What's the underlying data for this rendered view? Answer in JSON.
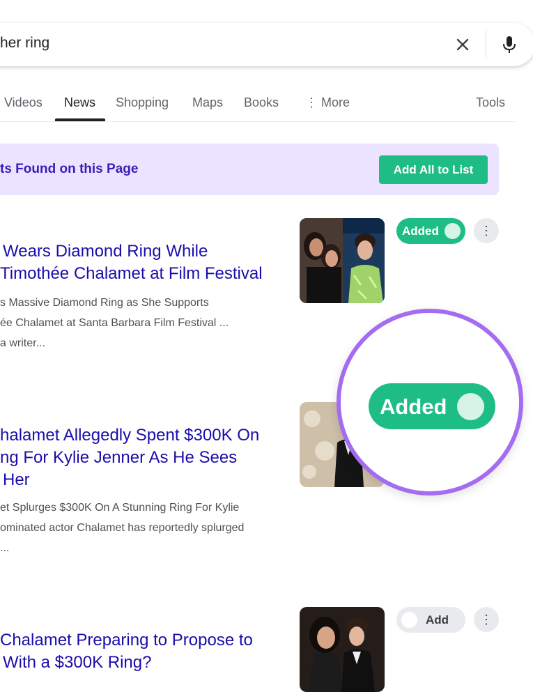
{
  "search": {
    "query_visible": "her ring"
  },
  "tabs": [
    {
      "label": "Videos"
    },
    {
      "label": "News"
    },
    {
      "label": "Shopping"
    },
    {
      "label": "Maps"
    },
    {
      "label": "Books"
    },
    {
      "label": "More"
    },
    {
      "label": "Tools"
    }
  ],
  "banner": {
    "text": "ts Found on this Page",
    "button_label": "Add All to List"
  },
  "results": [
    {
      "title_lines": [
        "Wears Diamond Ring While",
        "Timothée Chalamet at Film Festival"
      ],
      "snippet_lines": [
        "s Massive Diamond Ring as She Supports",
        "ée Chalamet at Santa Barbara Film Festival ...",
        "a writer..."
      ],
      "toggle_label": "Added",
      "toggle_state": "on"
    },
    {
      "title_lines": [
        "halamet Allegedly Spent $300K On",
        "ng For Kylie Jenner As He Sees",
        "Her"
      ],
      "snippet_lines": [
        "et Splurges $300K On A Stunning Ring For Kylie",
        "ominated actor Chalamet has reportedly splurged",
        "..."
      ]
    },
    {
      "title_lines": [
        "Chalamet Preparing to Propose to",
        "With a $300K Ring?"
      ],
      "toggle_label": "Add",
      "toggle_state": "off"
    }
  ],
  "zoom_callout": {
    "label": "Added"
  },
  "colors": {
    "accent_green": "#1fbd86",
    "banner_bg": "#ebe3ff",
    "banner_text": "#3b1db8",
    "link_blue": "#1a0dab",
    "callout_ring": "#a46cf0"
  },
  "icons": {
    "clear": "close-icon",
    "mic": "microphone-icon",
    "more_tabs": "vertical-dots-icon",
    "result_menu": "vertical-dots-icon"
  }
}
